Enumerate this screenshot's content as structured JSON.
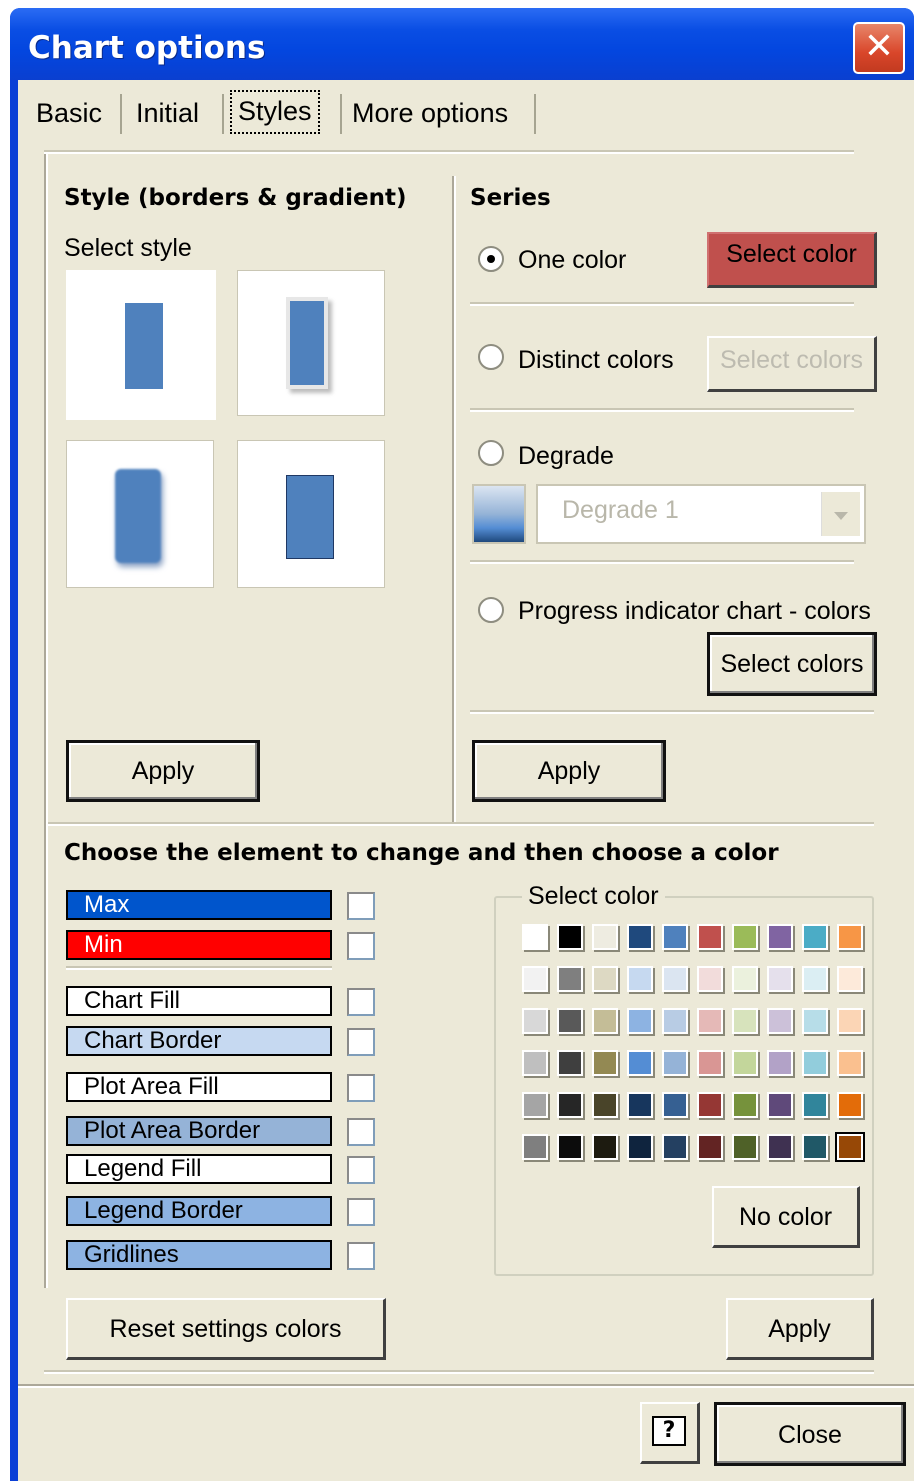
{
  "window": {
    "title": "Chart options"
  },
  "tabs": [
    {
      "label": "Basic"
    },
    {
      "label": "Initial"
    },
    {
      "label": "Styles"
    },
    {
      "label": "More options"
    }
  ],
  "style_section": {
    "heading": "Style (borders & gradient)",
    "select_label": "Select style",
    "apply_label": "Apply"
  },
  "series_section": {
    "heading": "Series",
    "one_color": "One color",
    "select_color_button": "Select color",
    "distinct_colors": "Distinct colors",
    "select_colors_disabled": "Select colors",
    "degrade": "Degrade",
    "degrade_value": "Degrade 1",
    "progress": "Progress indicator chart - colors",
    "select_colors_button": "Select colors",
    "apply_label": "Apply",
    "selected_mode": "One color"
  },
  "element_section": {
    "heading": "Choose the element to change and then choose a color",
    "elements": [
      {
        "label": "Max",
        "color": "#0055cc",
        "text_color": "#ffffff"
      },
      {
        "label": "Min",
        "color": "#ff0000",
        "text_color": "#ffffff"
      },
      {
        "label": "Chart Fill",
        "color": "#ffffff",
        "text_color": "#000000"
      },
      {
        "label": "Chart Border",
        "color": "#c6d9f1",
        "text_color": "#000000"
      },
      {
        "label": "Plot Area Fill",
        "color": "#ffffff",
        "text_color": "#000000"
      },
      {
        "label": "Plot Area Border",
        "color": "#95b3d7",
        "text_color": "#000000"
      },
      {
        "label": "Legend Fill",
        "color": "#ffffff",
        "text_color": "#000000"
      },
      {
        "label": "Legend Border",
        "color": "#8db3e2",
        "text_color": "#000000"
      },
      {
        "label": "Gridlines",
        "color": "#8db3e2",
        "text_color": "#000000"
      }
    ],
    "select_color_label": "Select color",
    "no_color_label": "No color",
    "reset_label": "Reset settings colors",
    "apply_label": "Apply"
  },
  "palette": [
    [
      "#ffffff",
      "#000000",
      "#eeece1",
      "#1f497d",
      "#4f81bd",
      "#c0504d",
      "#9bbb59",
      "#8064a2",
      "#4bacc6",
      "#f79646"
    ],
    [
      "#f2f2f2",
      "#7f7f7f",
      "#ddd9c3",
      "#c6d9f0",
      "#dbe5f1",
      "#f2dcdb",
      "#ebf1dd",
      "#e5e0ec",
      "#dbeef3",
      "#fdeada"
    ],
    [
      "#d8d8d8",
      "#595959",
      "#c4bd97",
      "#8db3e2",
      "#b8cce4",
      "#e5b9b7",
      "#d7e3bc",
      "#ccc1d9",
      "#b7dde8",
      "#fbd5b5"
    ],
    [
      "#bfbfbf",
      "#3f3f3f",
      "#938953",
      "#548dd4",
      "#95b3d7",
      "#d99694",
      "#c3d69b",
      "#b2a2c7",
      "#92cddc",
      "#fac08f"
    ],
    [
      "#a5a5a5",
      "#262626",
      "#494429",
      "#17365d",
      "#366092",
      "#953734",
      "#76923c",
      "#5f497a",
      "#31859b",
      "#e36c09"
    ],
    [
      "#7f7f7f",
      "#0c0c0c",
      "#1d1b10",
      "#0f243e",
      "#244061",
      "#632423",
      "#4f6128",
      "#3f3151",
      "#205867",
      "#974806"
    ]
  ],
  "footer": {
    "help_icon": "help-icon",
    "close_label": "Close"
  }
}
